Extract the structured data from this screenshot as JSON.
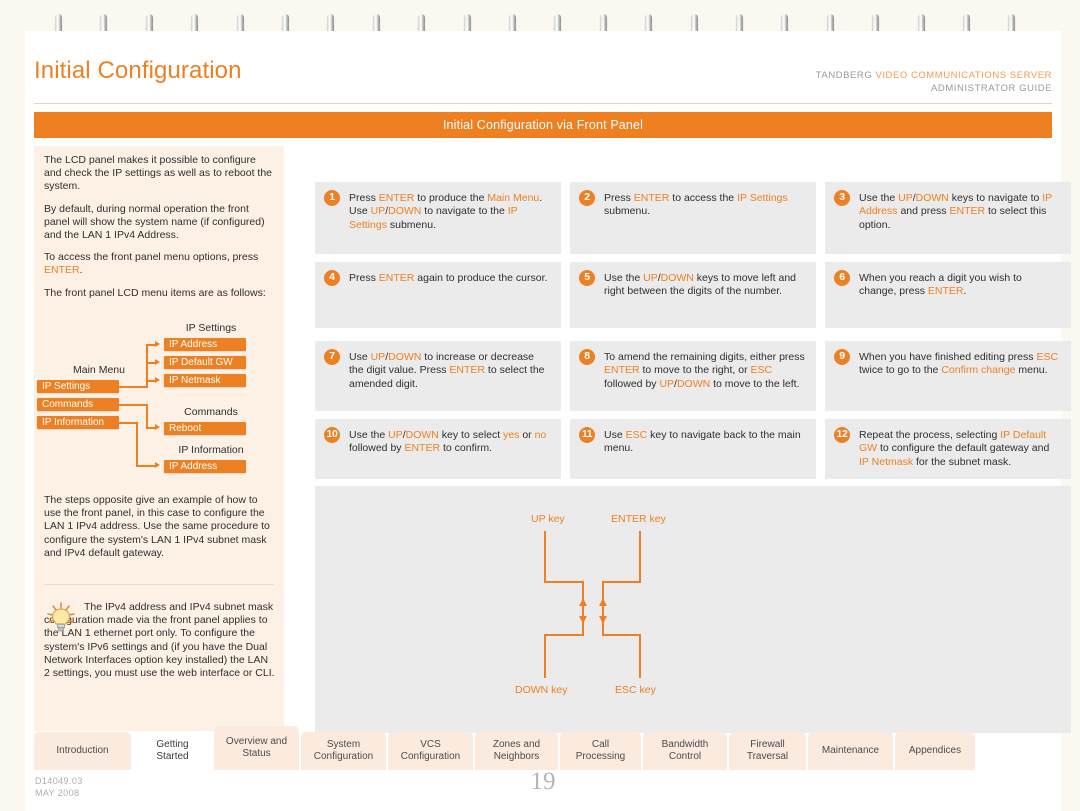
{
  "document": {
    "title": "Initial Configuration",
    "brand_prefix": "TANDBERG ",
    "brand_product": "VIDEO COMMUNICATIONS SERVER",
    "brand_subtitle": "ADMINISTRATOR GUIDE",
    "banner": "Initial Configuration via Front Panel",
    "doc_id": "D14049.03",
    "doc_date": "MAY 2008",
    "page_number": "19",
    "accent": "#ee8024",
    "banner_bg": "#ef8022",
    "panel_bg": "#ebebeb",
    "sidebar_bg": "#fdf0e5"
  },
  "sidebar": {
    "paragraphs": [
      "The LCD panel makes it possible to configure and check the IP settings as well as to reboot the system.",
      "By default, during normal operation the front panel will show the system name (if configured) and the LAN 1 IPv4 Address.",
      "To access the front panel menu options, press ENTER.",
      "The front panel LCD menu items are as follows:"
    ],
    "para3_prefix": "To access the front panel menu options, press ",
    "para3_keyword": "ENTER",
    "para3_suffix": ".",
    "steps_note": "The steps opposite give an example of how to use the front panel, in this case to configure the LAN 1 IPv4 address.  Use the same procedure to configure the system's LAN 1 IPv4 subnet mask and IPv4 default gateway.",
    "tip": "The IPv4 address and IPv4 subnet mask configuration made via the front panel applies to the LAN 1 ethernet port only. To configure the system's IPv6 settings and (if you have the Dual Network Interfaces option key installed) the LAN 2 settings, you must use the web interface or CLI."
  },
  "menu_tree": {
    "main_menu_caption": "Main Menu",
    "main_menu_items": [
      "IP Settings",
      "Commands",
      "IP Information"
    ],
    "groups": [
      {
        "caption": "IP Settings",
        "items": [
          "IP Address",
          "IP Default GW",
          "IP Netmask"
        ]
      },
      {
        "caption": "Commands",
        "items": [
          "Reboot"
        ]
      },
      {
        "caption": "IP Information",
        "items": [
          "IP Address"
        ]
      }
    ]
  },
  "steps": [
    {
      "num": "1",
      "parts": [
        {
          "t": "Press ",
          "k": false
        },
        {
          "t": "ENTER",
          "k": true
        },
        {
          "t": " to produce the ",
          "k": false
        },
        {
          "t": "Main Menu",
          "k": true
        },
        {
          "t": ". Use ",
          "k": false
        },
        {
          "t": "UP",
          "k": true
        },
        {
          "t": "/",
          "k": false
        },
        {
          "t": "DOWN",
          "k": true
        },
        {
          "t": " to navigate to the ",
          "k": false
        },
        {
          "t": "IP Settings",
          "k": true
        },
        {
          "t": " submenu.",
          "k": false
        }
      ]
    },
    {
      "num": "2",
      "parts": [
        {
          "t": "Press ",
          "k": false
        },
        {
          "t": "ENTER",
          "k": true
        },
        {
          "t": " to access the ",
          "k": false
        },
        {
          "t": "IP Settings",
          "k": true
        },
        {
          "t": " submenu.",
          "k": false
        }
      ]
    },
    {
      "num": "3",
      "parts": [
        {
          "t": "Use the ",
          "k": false
        },
        {
          "t": "UP",
          "k": true
        },
        {
          "t": "/",
          "k": false
        },
        {
          "t": "DOWN",
          "k": true
        },
        {
          "t": " keys to navigate to ",
          "k": false
        },
        {
          "t": "IP Address",
          "k": true
        },
        {
          "t": " and press ",
          "k": false
        },
        {
          "t": "ENTER",
          "k": true
        },
        {
          "t": " to select this option.",
          "k": false
        }
      ]
    },
    {
      "num": "4",
      "parts": [
        {
          "t": "Press ",
          "k": false
        },
        {
          "t": "ENTER",
          "k": true
        },
        {
          "t": " again to produce the cursor.",
          "k": false
        }
      ]
    },
    {
      "num": "5",
      "parts": [
        {
          "t": "Use the ",
          "k": false
        },
        {
          "t": "UP",
          "k": true
        },
        {
          "t": "/",
          "k": false
        },
        {
          "t": "DOWN",
          "k": true
        },
        {
          "t": " keys to move left and right between the digits of the number.",
          "k": false
        }
      ]
    },
    {
      "num": "6",
      "parts": [
        {
          "t": "When you reach a digit you wish to change, press ",
          "k": false
        },
        {
          "t": "ENTER",
          "k": true
        },
        {
          "t": ".",
          "k": false
        }
      ]
    },
    {
      "num": "7",
      "parts": [
        {
          "t": "Use ",
          "k": false
        },
        {
          "t": "UP",
          "k": true
        },
        {
          "t": "/",
          "k": false
        },
        {
          "t": "DOWN",
          "k": true
        },
        {
          "t": " to increase or decrease the digit value.  Press ",
          "k": false
        },
        {
          "t": "ENTER",
          "k": true
        },
        {
          "t": " to select the amended digit.",
          "k": false
        }
      ]
    },
    {
      "num": "8",
      "parts": [
        {
          "t": "To amend the remaining digits, either press ",
          "k": false
        },
        {
          "t": "ENTER",
          "k": true
        },
        {
          "t": " to move to the right, or ",
          "k": false
        },
        {
          "t": "ESC",
          "k": true
        },
        {
          "t": " followed by ",
          "k": false
        },
        {
          "t": "UP",
          "k": true
        },
        {
          "t": "/",
          "k": false
        },
        {
          "t": "DOWN",
          "k": true
        },
        {
          "t": " to move to the left.",
          "k": false
        }
      ]
    },
    {
      "num": "9",
      "parts": [
        {
          "t": "When you have finished editing press ",
          "k": false
        },
        {
          "t": "ESC",
          "k": true
        },
        {
          "t": " twice to go to the ",
          "k": false
        },
        {
          "t": "Confirm change",
          "k": true
        },
        {
          "t": " menu.",
          "k": false
        }
      ]
    },
    {
      "num": "10",
      "parts": [
        {
          "t": "Use the ",
          "k": false
        },
        {
          "t": "UP",
          "k": true
        },
        {
          "t": "/",
          "k": false
        },
        {
          "t": "DOWN",
          "k": true
        },
        {
          "t": " key to select ",
          "k": false
        },
        {
          "t": "yes",
          "k": true
        },
        {
          "t": " or ",
          "k": false
        },
        {
          "t": "no",
          "k": true
        },
        {
          "t": " followed by ",
          "k": false
        },
        {
          "t": "ENTER",
          "k": true
        },
        {
          "t": " to confirm.",
          "k": false
        }
      ]
    },
    {
      "num": "11",
      "parts": [
        {
          "t": "Use ",
          "k": false
        },
        {
          "t": "ESC",
          "k": true
        },
        {
          "t": " key to navigate back to the main menu.",
          "k": false
        }
      ]
    },
    {
      "num": "12",
      "parts": [
        {
          "t": "Repeat the process, selecting ",
          "k": false
        },
        {
          "t": "IP Default GW",
          "k": true
        },
        {
          "t": " to configure the default gateway and ",
          "k": false
        },
        {
          "t": "IP Netmask",
          "k": true
        },
        {
          "t": " for the subnet mask.",
          "k": false
        }
      ]
    }
  ],
  "key_diagram": {
    "labels": {
      "up": "UP key",
      "enter": "ENTER key",
      "down": "DOWN key",
      "esc": "ESC key"
    }
  },
  "tabs": [
    {
      "label": "Introduction",
      "active": false,
      "raised": false
    },
    {
      "label": "Getting Started",
      "active": true,
      "raised": false
    },
    {
      "label": "Overview and Status",
      "active": false,
      "raised": true
    },
    {
      "label": "System Configuration",
      "active": false,
      "raised": false
    },
    {
      "label": "VCS Configuration",
      "active": false,
      "raised": false
    },
    {
      "label": "Zones and Neighbors",
      "active": false,
      "raised": false
    },
    {
      "label": "Call Processing",
      "active": false,
      "raised": false
    },
    {
      "label": "Bandwidth Control",
      "active": false,
      "raised": false
    },
    {
      "label": "Firewall Traversal",
      "active": false,
      "raised": false
    },
    {
      "label": "Maintenance",
      "active": false,
      "raised": false
    },
    {
      "label": "Appendices",
      "active": false,
      "raised": false
    }
  ]
}
